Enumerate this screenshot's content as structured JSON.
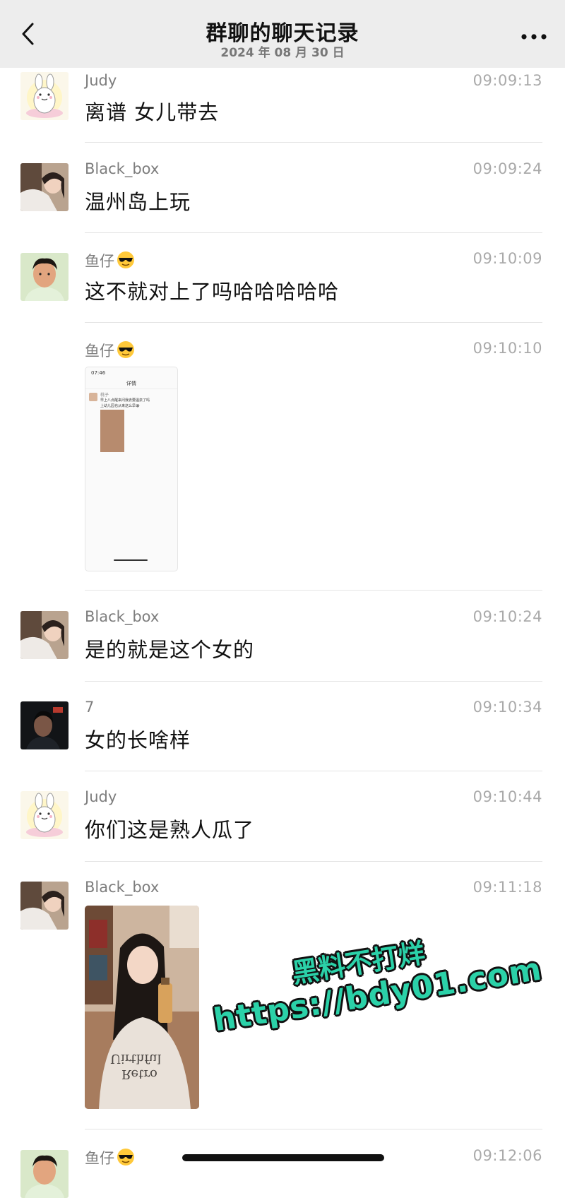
{
  "header": {
    "title": "群聊的聊天记录",
    "subtitle": "2024 年 08 月 30 日",
    "back_icon": "chevron-left-icon",
    "more_icon": "more-dots-icon"
  },
  "messages": [
    {
      "sender": "Judy",
      "time": "09:09:13",
      "text": "离谱  女儿带去",
      "avatar": "bunny-avatar"
    },
    {
      "sender": "Black_box",
      "time": "09:09:24",
      "text": "温州岛上玩",
      "avatar": "girl-photo-avatar"
    },
    {
      "sender": "鱼仔",
      "emoji": "sunglasses-emoji",
      "time": "09:10:09",
      "text": "这不就对上了吗哈哈哈哈哈",
      "avatar": "boy-photo-avatar"
    },
    {
      "sender": "鱼仔",
      "emoji": "sunglasses-emoji",
      "time": "09:10:10",
      "image": "screenshot-thumbnail"
    },
    {
      "sender": "Black_box",
      "time": "09:10:24",
      "text": "是的就是这个女的",
      "avatar": "girl-photo-avatar"
    },
    {
      "sender": "7",
      "time": "09:10:34",
      "text": "女的长啥样",
      "avatar": "dark-photo-avatar"
    },
    {
      "sender": "Judy",
      "time": "09:10:44",
      "text": "你们这是熟人瓜了",
      "avatar": "bunny-avatar"
    },
    {
      "sender": "Black_box",
      "time": "09:11:18",
      "image": "woman-photo",
      "avatar": "girl-photo-avatar"
    },
    {
      "sender": "鱼仔",
      "emoji": "sunglasses-emoji",
      "time": "09:12:06",
      "avatar": "boy-photo-avatar"
    }
  ],
  "embedded_screenshot": {
    "status_time": "07:46",
    "title": "详情",
    "name": "桃子",
    "text_line1": "早上八点醒来问我去要温泉了吗",
    "text_line2": "上幼儿园也从来这么早😭"
  },
  "woman_photo": {
    "shirt_text1": "Uirthful",
    "shirt_text2": "Retro"
  },
  "watermark": {
    "line1": "黑料不打烊",
    "line2": "https://bdy01.com"
  },
  "colors": {
    "header_bg": "#ededed",
    "watermark": "#2bd1a8",
    "time": "#aaaaaa",
    "name": "#7d7d7d"
  }
}
